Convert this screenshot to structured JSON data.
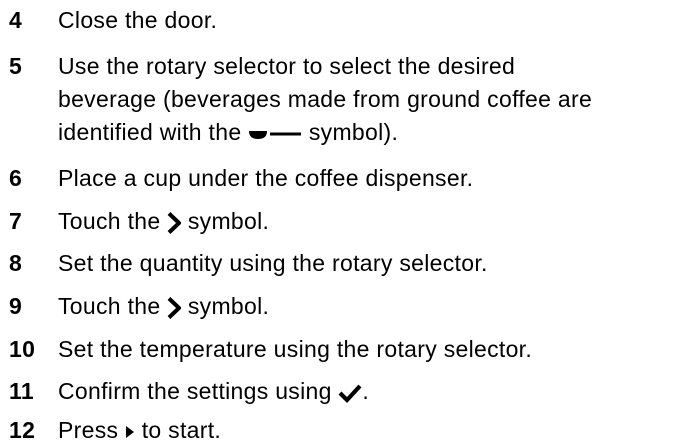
{
  "steps": [
    {
      "number": "4",
      "text": "Close the door."
    },
    {
      "number": "5",
      "line1": "Use the rotary selector to select the desired",
      "line2": "beverage (beverages made from ground coffee are",
      "line3_before": "identified with the",
      "line3_after": "symbol).",
      "icon": "ground-coffee-icon"
    },
    {
      "number": "6",
      "text": "Place a cup under the coffee dispenser."
    },
    {
      "number": "7",
      "before": "Touch the",
      "after": "symbol.",
      "icon": "chevron-right-icon"
    },
    {
      "number": "8",
      "text": "Set the quantity using the rotary selector."
    },
    {
      "number": "9",
      "before": "Touch the",
      "after": "symbol.",
      "icon": "chevron-right-icon"
    },
    {
      "number": "10",
      "text": "Set the temperature using the rotary selector."
    },
    {
      "number": "11",
      "before": "Confirm the settings using",
      "after": ".",
      "icon": "checkmark-icon"
    },
    {
      "number": "12",
      "before": "Press",
      "after": "to start.",
      "icon": "play-triangle-icon"
    }
  ]
}
